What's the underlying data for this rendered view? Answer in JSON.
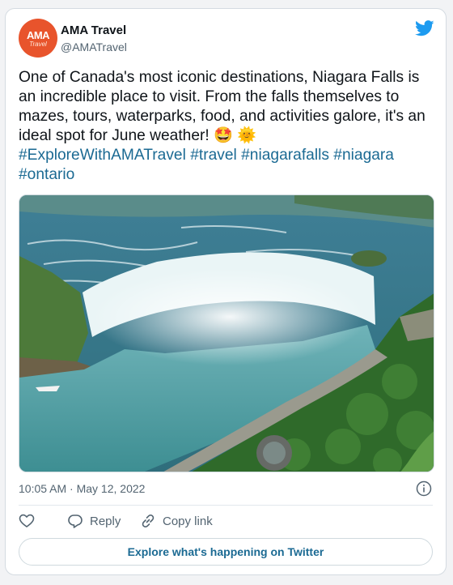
{
  "author": {
    "name": "AMA Travel",
    "handle": "@AMATravel",
    "avatar_text": "AMA",
    "avatar_subtext": "Travel",
    "avatar_color": "#e8542c"
  },
  "tweet": {
    "text": "One of Canada's most iconic destinations, Niagara Falls is an incredible place to visit. From the falls themselves to mazes, tours, waterparks, food, and activities galore, it's an ideal spot for June weather!",
    "emojis": "🤩 🌞",
    "hashtags": [
      "#ExploreWithAMATravel",
      "#travel",
      "#niagarafalls",
      "#niagara",
      "#ontario"
    ]
  },
  "media": {
    "icon": "niagara-falls-photo"
  },
  "meta": {
    "timestamp": "10:05 AM · May 12, 2022"
  },
  "actions": {
    "reply_label": "Reply",
    "copy_label": "Copy link"
  },
  "explore_label": "Explore what's happening on Twitter",
  "colors": {
    "twitter_blue": "#1d9bf0",
    "hashtag": "#1b6a93",
    "secondary_text": "#536471"
  }
}
